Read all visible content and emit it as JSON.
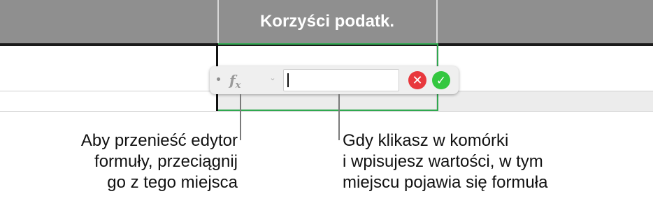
{
  "spreadsheet": {
    "column_header": "Korzyści podatk."
  },
  "formula_editor": {
    "fx_label": "f",
    "fx_sub": "x",
    "input_value": "",
    "chevron": "⌄",
    "cancel_symbol": "✕",
    "confirm_symbol": "✓"
  },
  "callouts": {
    "left": {
      "line1": "Aby przenieść edytor",
      "line2": "formuły, przeciągnij",
      "line3": "go z tego miejsca"
    },
    "right": {
      "line1": "Gdy klikasz w komórki",
      "line2": "i wpisujesz wartości, w tym",
      "line3": "miejscu pojawia się formuła"
    }
  },
  "colors": {
    "header_bg": "#8f8f8f",
    "selection": "#2fa84f",
    "cancel": "#e8383d",
    "confirm": "#34c740"
  }
}
